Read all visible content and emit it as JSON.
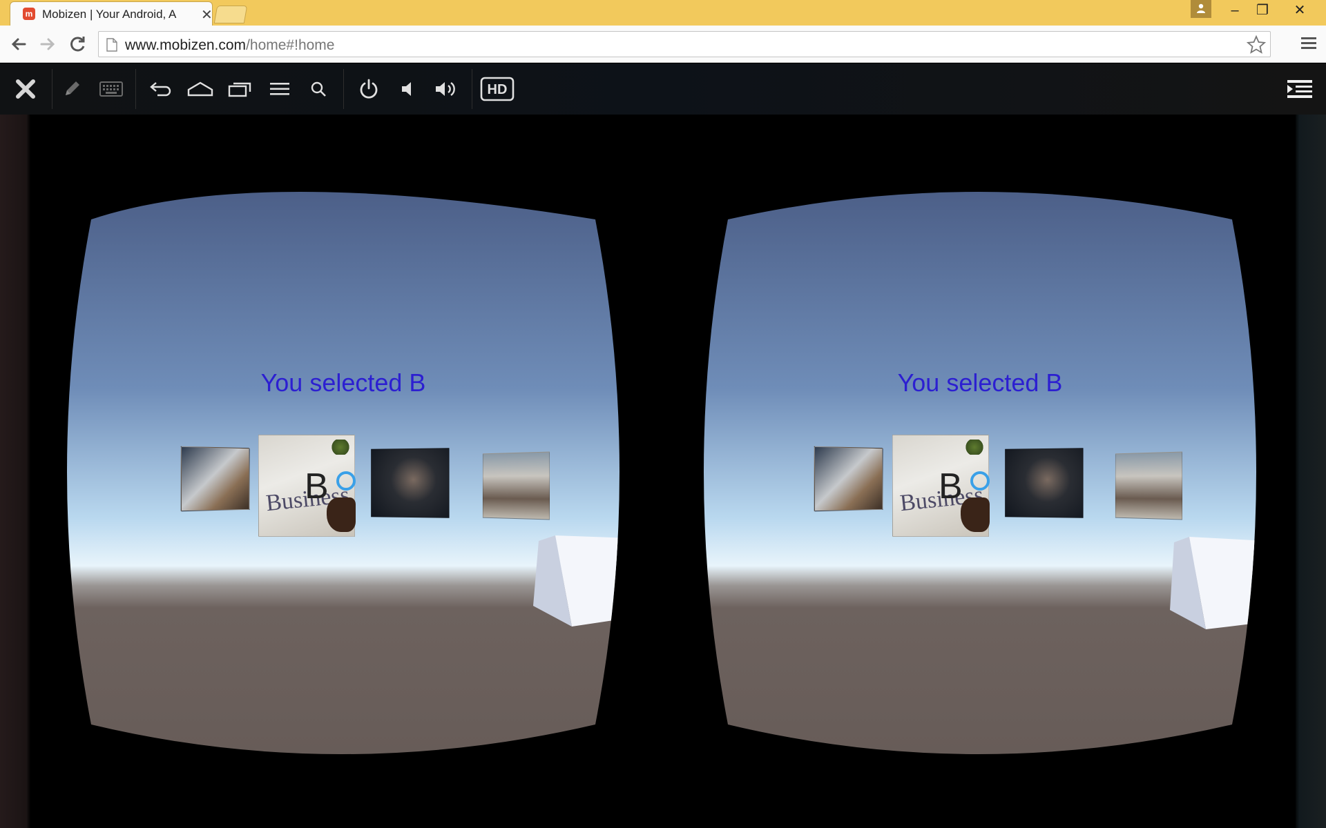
{
  "browser": {
    "tab": {
      "title": "Mobizen | Your Android, A",
      "favicon_letter": "m",
      "close_glyph": "✕"
    },
    "address": {
      "host": "www.mobizen.com",
      "path": "/home#!home"
    },
    "window_controls": {
      "minimize": "–",
      "maximize": "❐",
      "close": "✕"
    }
  },
  "mobizen_toolbar": {
    "buttons": [
      "close-icon",
      "pen-icon",
      "keyboard-icon",
      "back-icon",
      "home-icon",
      "recent-apps-icon",
      "menu-icon",
      "search-icon",
      "power-icon",
      "volume-down-icon",
      "volume-up-icon",
      "hd-icon",
      "side-panel-icon"
    ],
    "hd_label": "HD"
  },
  "vr_view": {
    "left": {
      "message": "You selected B",
      "thumbnails": [
        {
          "id": "a"
        },
        {
          "id": "b",
          "letter": "B",
          "caption": "Business"
        },
        {
          "id": "c"
        },
        {
          "id": "d"
        }
      ]
    },
    "right": {
      "message": "You selected B",
      "thumbnails": [
        {
          "id": "a"
        },
        {
          "id": "b",
          "letter": "B",
          "caption": "Business"
        },
        {
          "id": "c"
        },
        {
          "id": "d"
        }
      ]
    }
  },
  "colors": {
    "titlebar": "#f2c95c",
    "sky_top": "#4c5f88",
    "sky_horizon": "#cfe6f4",
    "ground": "#6c625e",
    "message_text": "#2c1fd1",
    "cursor_ring": "#3aa0e8"
  }
}
